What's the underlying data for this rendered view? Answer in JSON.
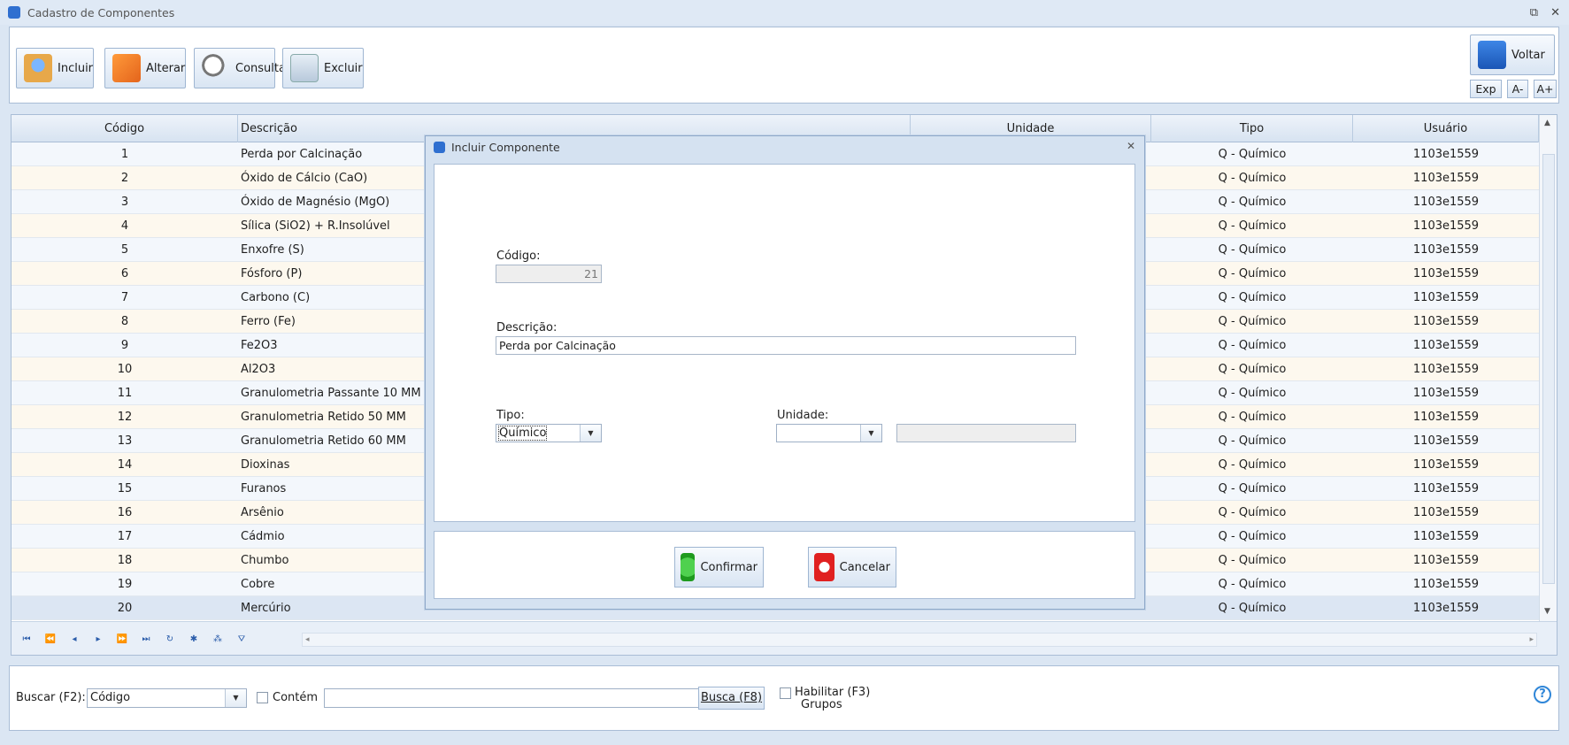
{
  "window": {
    "title": "Cadastro de Componentes",
    "controls": [
      "⧉",
      "✕"
    ]
  },
  "toolbar": {
    "incluir": "Incluir",
    "alterar": "Alterar",
    "consultar": "Consultar",
    "excluir": "Excluir",
    "voltar": "Voltar",
    "exp": "Exp",
    "font_minus": "A-",
    "font_plus": "A+"
  },
  "grid": {
    "headers": {
      "codigo": "Código",
      "descricao": "Descrição",
      "unidade": "Unidade",
      "tipo": "Tipo",
      "usuario": "Usuário"
    },
    "rows": [
      {
        "codigo": "1",
        "descricao": "Perda por Calcinação",
        "tipo": "Q - Químico",
        "usuario": "1103e1559"
      },
      {
        "codigo": "2",
        "descricao": "Óxido de Cálcio (CaO)",
        "tipo": "Q - Químico",
        "usuario": "1103e1559"
      },
      {
        "codigo": "3",
        "descricao": "Óxido de Magnésio (MgO)",
        "tipo": "Q - Químico",
        "usuario": "1103e1559"
      },
      {
        "codigo": "4",
        "descricao": "Sílica (SiO2) + R.Insolúvel",
        "tipo": "Q - Químico",
        "usuario": "1103e1559"
      },
      {
        "codigo": "5",
        "descricao": "Enxofre (S)",
        "tipo": "Q - Químico",
        "usuario": "1103e1559"
      },
      {
        "codigo": "6",
        "descricao": "Fósforo (P)",
        "tipo": "Q - Químico",
        "usuario": "1103e1559"
      },
      {
        "codigo": "7",
        "descricao": "Carbono (C)",
        "tipo": "Q - Químico",
        "usuario": "1103e1559"
      },
      {
        "codigo": "8",
        "descricao": "Ferro (Fe)",
        "tipo": "Q - Químico",
        "usuario": "1103e1559"
      },
      {
        "codigo": "9",
        "descricao": "Fe2O3",
        "tipo": "Q - Químico",
        "usuario": "1103e1559"
      },
      {
        "codigo": "10",
        "descricao": "Al2O3",
        "tipo": "Q - Químico",
        "usuario": "1103e1559"
      },
      {
        "codigo": "11",
        "descricao": "Granulometria Passante 10 MM",
        "tipo": "Q - Químico",
        "usuario": "1103e1559"
      },
      {
        "codigo": "12",
        "descricao": "Granulometria Retido 50 MM",
        "tipo": "Q - Químico",
        "usuario": "1103e1559"
      },
      {
        "codigo": "13",
        "descricao": "Granulometria Retido 60 MM",
        "tipo": "Q - Químico",
        "usuario": "1103e1559"
      },
      {
        "codigo": "14",
        "descricao": "Dioxinas",
        "tipo": "Q - Químico",
        "usuario": "1103e1559"
      },
      {
        "codigo": "15",
        "descricao": "Furanos",
        "tipo": "Q - Químico",
        "usuario": "1103e1559"
      },
      {
        "codigo": "16",
        "descricao": "Arsênio",
        "tipo": "Q - Químico",
        "usuario": "1103e1559"
      },
      {
        "codigo": "17",
        "descricao": "Cádmio",
        "tipo": "Q - Químico",
        "usuario": "1103e1559"
      },
      {
        "codigo": "18",
        "descricao": "Chumbo",
        "tipo": "Q - Químico",
        "usuario": "1103e1559"
      },
      {
        "codigo": "19",
        "descricao": "Cobre",
        "tipo": "Q - Químico",
        "usuario": "1103e1559"
      },
      {
        "codigo": "20",
        "descricao": "Mercúrio",
        "tipo": "Q - Químico",
        "usuario": "1103e1559"
      }
    ]
  },
  "search": {
    "label": "Buscar (F2):",
    "field_value": "Código",
    "contem_label": "Contém",
    "query_value": "",
    "busca_button": "Busca (F8)",
    "habilitar_label": "Habilitar (F3)",
    "grupos_label": "Grupos",
    "help": "?"
  },
  "modal": {
    "title": "Incluir Componente",
    "close": "✕",
    "codigo_label": "Código:",
    "codigo_value": "21",
    "descricao_label": "Descrição:",
    "descricao_value": "Perda por Calcinação",
    "tipo_label": "Tipo:",
    "tipo_value": "Químico",
    "unidade_label": "Unidade:",
    "unidade_value": "",
    "unidade_desc_value": "",
    "confirmar": "Confirmar",
    "cancelar": "Cancelar"
  }
}
